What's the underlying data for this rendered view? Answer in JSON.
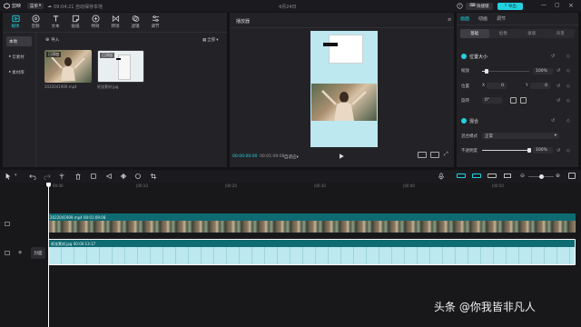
{
  "titlebar": {
    "logo": "剪映",
    "menu": "菜单",
    "autosave": "09:04:21 自动保存本地",
    "project_name": "4月24日",
    "shortcut": "快捷键",
    "export": "导出"
  },
  "toolbar": {
    "items": [
      {
        "label": "媒体",
        "icon": "media-icon"
      },
      {
        "label": "音频",
        "icon": "audio-icon"
      },
      {
        "label": "文本",
        "icon": "text-icon"
      },
      {
        "label": "贴纸",
        "icon": "sticker-icon"
      },
      {
        "label": "特效",
        "icon": "effect-icon"
      },
      {
        "label": "转场",
        "icon": "transition-icon"
      },
      {
        "label": "滤镜",
        "icon": "filter-icon"
      },
      {
        "label": "调节",
        "icon": "adjust-icon"
      }
    ]
  },
  "media_sidebar": {
    "items": [
      "本地",
      "云素材",
      "素材库"
    ]
  },
  "media_panel": {
    "import_label": "导入",
    "view_label": "全部",
    "clips": [
      {
        "name": "2022041909.mp4",
        "added": "已添加"
      },
      {
        "name": "纸张素材.jpg",
        "added": "已添加"
      }
    ]
  },
  "player": {
    "title": "播放器",
    "current_time": "00:00:00:00",
    "total_time": "00:01:09:08",
    "ratio": "自适应"
  },
  "inspector": {
    "tabs": [
      "画面",
      "动画",
      "调节"
    ],
    "subtabs": [
      "基础",
      "抠像",
      "蒙版",
      "背景"
    ],
    "position_section": "位置大小",
    "scale_label": "缩放",
    "scale_value": "100%",
    "position_label": "位置",
    "pos_x": "0",
    "pos_y": "0",
    "rotate_label": "旋转",
    "rotate_value": "0°",
    "blend_section": "混合",
    "blend_mode_label": "混合模式",
    "blend_mode_value": "正常",
    "opacity_label": "不透明度",
    "opacity_value": "100%",
    "scale_fraction": 0.1,
    "opacity_fraction": 1.0
  },
  "timeline": {
    "ruler": [
      "00:00",
      "|00:10",
      "|00:20",
      "|00:30",
      "|00:40",
      "|00:50"
    ],
    "video_track": {
      "label": "2022041909.mp4",
      "duration": "00:01:09:08"
    },
    "image_track": {
      "label": "纸张素材.jpg",
      "duration": "00:00:13:17"
    },
    "cover_label": "封面"
  },
  "watermark": "头条 @你我皆非凡人",
  "colors": {
    "accent": "#22d2e0",
    "video_track": "#0f6b72",
    "image_track": "#bde8f0"
  }
}
